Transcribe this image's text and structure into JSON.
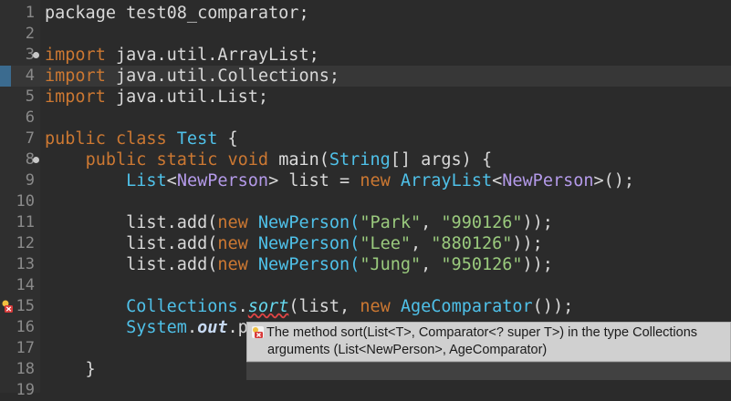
{
  "editor": {
    "lines": [
      {
        "n": "1",
        "parts": [
          {
            "t": "package test08_comparator;",
            "c": ""
          }
        ]
      },
      {
        "n": "2",
        "parts": []
      },
      {
        "n": "3",
        "fold": true,
        "parts": [
          {
            "t": "import",
            "c": "kw"
          },
          {
            "t": " java.util.ArrayList;",
            "c": ""
          }
        ]
      },
      {
        "n": "4",
        "current": true,
        "marker": true,
        "parts": [
          {
            "t": "import",
            "c": "kw"
          },
          {
            "t": " java.util.Collections;",
            "c": ""
          }
        ]
      },
      {
        "n": "5",
        "parts": [
          {
            "t": "import",
            "c": "kw"
          },
          {
            "t": " java.util.List;",
            "c": ""
          }
        ]
      },
      {
        "n": "6",
        "parts": []
      },
      {
        "n": "7",
        "parts": [
          {
            "t": "public class ",
            "c": "kw"
          },
          {
            "t": "Test",
            "c": "cls"
          },
          {
            "t": " {",
            "c": ""
          }
        ]
      },
      {
        "n": "8",
        "fold": true,
        "parts": [
          {
            "t": "    ",
            "c": ""
          },
          {
            "t": "public static void ",
            "c": "kw"
          },
          {
            "t": "main(",
            "c": "mth"
          },
          {
            "t": "String",
            "c": "cls"
          },
          {
            "t": "[] args) {",
            "c": ""
          }
        ]
      },
      {
        "n": "9",
        "parts": [
          {
            "t": "        ",
            "c": ""
          },
          {
            "t": "List",
            "c": "cls"
          },
          {
            "t": "<",
            "c": ""
          },
          {
            "t": "NewPerson",
            "c": "typ"
          },
          {
            "t": "> list = ",
            "c": ""
          },
          {
            "t": "new ",
            "c": "kw"
          },
          {
            "t": "ArrayList",
            "c": "cls"
          },
          {
            "t": "<",
            "c": ""
          },
          {
            "t": "NewPerson",
            "c": "typ"
          },
          {
            "t": ">();",
            "c": ""
          }
        ]
      },
      {
        "n": "10",
        "parts": []
      },
      {
        "n": "11",
        "parts": [
          {
            "t": "        list.add(",
            "c": ""
          },
          {
            "t": "new ",
            "c": "kw"
          },
          {
            "t": "NewPerson(",
            "c": "cls"
          },
          {
            "t": "\"Park\"",
            "c": "str"
          },
          {
            "t": ", ",
            "c": ""
          },
          {
            "t": "\"990126\"",
            "c": "str"
          },
          {
            "t": "));",
            "c": ""
          }
        ]
      },
      {
        "n": "12",
        "parts": [
          {
            "t": "        list.add(",
            "c": ""
          },
          {
            "t": "new ",
            "c": "kw"
          },
          {
            "t": "NewPerson(",
            "c": "cls"
          },
          {
            "t": "\"Lee\"",
            "c": "str"
          },
          {
            "t": ", ",
            "c": ""
          },
          {
            "t": "\"880126\"",
            "c": "str"
          },
          {
            "t": "));",
            "c": ""
          }
        ]
      },
      {
        "n": "13",
        "parts": [
          {
            "t": "        list.add(",
            "c": ""
          },
          {
            "t": "new ",
            "c": "kw"
          },
          {
            "t": "NewPerson(",
            "c": "cls"
          },
          {
            "t": "\"Jung\"",
            "c": "str"
          },
          {
            "t": ", ",
            "c": ""
          },
          {
            "t": "\"950126\"",
            "c": "str"
          },
          {
            "t": "));",
            "c": ""
          }
        ]
      },
      {
        "n": "14",
        "parts": []
      },
      {
        "n": "15",
        "error": true,
        "parts": [
          {
            "t": "        ",
            "c": ""
          },
          {
            "t": "Collections",
            "c": "cls"
          },
          {
            "t": ".",
            "c": ""
          },
          {
            "t": "sort",
            "c": "itf err"
          },
          {
            "t": "(list, ",
            "c": ""
          },
          {
            "t": "new ",
            "c": "kw"
          },
          {
            "t": "AgeComparator",
            "c": "cls"
          },
          {
            "t": "());",
            "c": ""
          }
        ]
      },
      {
        "n": "16",
        "parts": [
          {
            "t": "        ",
            "c": ""
          },
          {
            "t": "System",
            "c": "cls"
          },
          {
            "t": ".",
            "c": ""
          },
          {
            "t": "out",
            "c": "fld"
          },
          {
            "t": ".p",
            "c": ""
          }
        ]
      },
      {
        "n": "17",
        "parts": []
      },
      {
        "n": "18",
        "parts": [
          {
            "t": "    }",
            "c": ""
          }
        ]
      },
      {
        "n": "19",
        "parts": []
      }
    ]
  },
  "tooltip": {
    "line1": "The method sort(List<T>, Comparator<? super T>) in the type Collections",
    "line2": "arguments (List<NewPerson>, AgeComparator)",
    "icon": "error-icon",
    "error_color": "#e04545"
  }
}
